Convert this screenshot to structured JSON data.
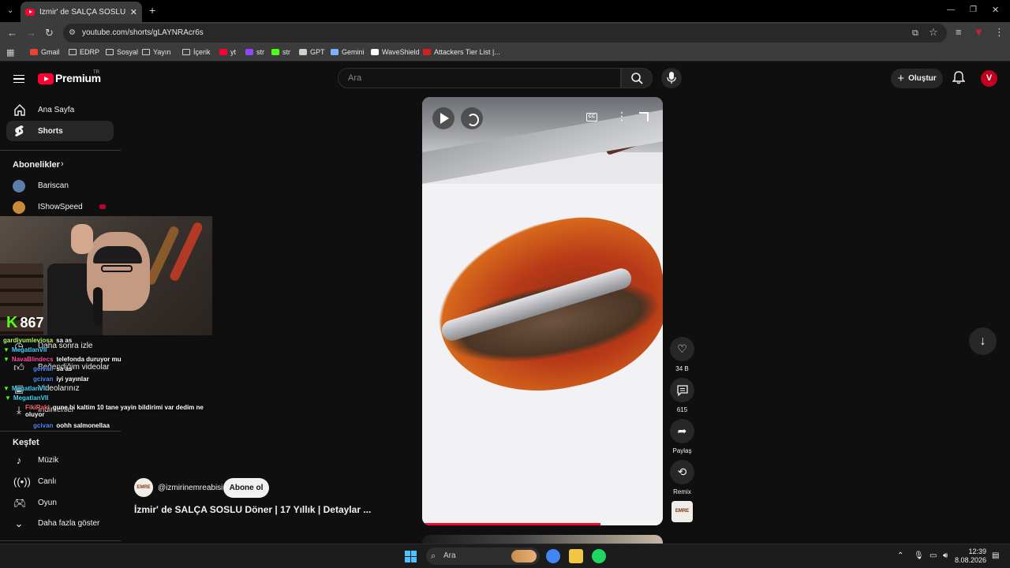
{
  "browser": {
    "tab_title": "İzmir' de SALÇA SOSLU Döner | ",
    "url": "youtube.com/shorts/gLAYNRAcr6s",
    "bookmarks": [
      {
        "label": "Gmail",
        "icon": "gmail-icon",
        "color": "#ea4335"
      },
      {
        "label": "EDRP",
        "icon": "folder-icon",
        "color": ""
      },
      {
        "label": "Sosyal",
        "icon": "folder-icon",
        "color": ""
      },
      {
        "label": "Yayın",
        "icon": "folder-icon",
        "color": ""
      },
      {
        "label": "İçerik",
        "icon": "folder-icon",
        "color": ""
      },
      {
        "label": "yt",
        "icon": "youtube-icon",
        "color": "#ff0033"
      },
      {
        "label": "str",
        "icon": "twitch-icon",
        "color": "#9146ff"
      },
      {
        "label": "str",
        "icon": "kick-icon",
        "color": "#53fc18"
      },
      {
        "label": "GPT",
        "icon": "openai-icon",
        "color": "#cfcfcf"
      },
      {
        "label": "Gemini",
        "icon": "gemini-icon",
        "color": "#7fb2ff"
      },
      {
        "label": "WaveShield",
        "icon": "waveshield-icon",
        "color": "#ffffff"
      },
      {
        "label": "Attackers Tier List |...",
        "icon": "tierlist-icon",
        "color": "#d02020"
      }
    ]
  },
  "header": {
    "logo_text": "Premium",
    "region": "TR",
    "search_placeholder": "Ara",
    "create_label": "Oluştur",
    "avatar_letter": "V"
  },
  "sidebar": {
    "main": [
      {
        "label": "Ana Sayfa",
        "icon": "home-icon"
      },
      {
        "label": "Shorts",
        "icon": "shorts-icon",
        "active": true
      }
    ],
    "subscriptions_heading": "Abonelikler",
    "subscriptions": [
      {
        "label": "Bariscan",
        "color": "#5b7ea8"
      },
      {
        "label": "IShowSpeed",
        "color": "#c98b3a"
      }
    ],
    "you_items": [
      {
        "label": "Daha sonra izle",
        "icon": "watch-later-icon"
      },
      {
        "label": "Beğendiğim videolar",
        "icon": "like-icon"
      },
      {
        "label": "Videolarınız",
        "icon": "your-videos-icon"
      },
      {
        "label": "İndirilenler",
        "icon": "download-icon"
      }
    ],
    "explore_heading": "Keşfet",
    "explore": [
      {
        "label": "Müzik",
        "icon": "music-icon"
      },
      {
        "label": "Canlı",
        "icon": "live-icon"
      },
      {
        "label": "Oyun",
        "icon": "gaming-icon"
      },
      {
        "label": "Daha fazla göster",
        "icon": "chevron-down-icon"
      }
    ]
  },
  "stream_overlay": {
    "viewer_count": "867",
    "chat": [
      {
        "user": "gardiyumleviosa",
        "msg": "sa as",
        "color": "#b6ff6a",
        "badge": ""
      },
      {
        "user": "MegatlanVII",
        "msg": "",
        "color": "#41d7ff",
        "badge": "▼"
      },
      {
        "user": "NavaBlindecs",
        "msg": "telefonda duruyor mu",
        "color": "#ff4f9a",
        "badge": "▼"
      },
      {
        "user": "gcivan",
        "msg": "sa as",
        "color": "#4f8bff",
        "badge": ""
      },
      {
        "user": "gcivan",
        "msg": "iyi yayınlar",
        "color": "#4f8bff",
        "badge": ""
      },
      {
        "user": "MegatlanVII",
        "msg": "",
        "color": "#41d7ff",
        "badge": "▼"
      },
      {
        "user": "MegatlanVII",
        "msg": "",
        "color": "#41d7ff",
        "badge": "▼"
      },
      {
        "user": "FikiRaki",
        "msg": "gune bi kaltim 10 tane yayin bildirimi var dedim ne oluyor",
        "color": "#ff6a6a",
        "badge": ""
      },
      {
        "user": "gcivan",
        "msg": "oohh salmonellaa",
        "color": "#4f8bff",
        "badge": ""
      }
    ]
  },
  "player": {
    "progress": 0.74,
    "cc_label": "CC"
  },
  "actions": {
    "likes": "34 B",
    "comments": "615",
    "share_label": "Paylaş",
    "remix_label": "Remix"
  },
  "video": {
    "channel": "@izmirinemreabisi",
    "subscribe_label": "Abone ol",
    "title": "İzmir' de SALÇA SOSLU Döner | 17 Yıllık | Detaylar ...",
    "channel_avatar_text": "EMRE",
    "audio_thumb_text": "EMRE"
  },
  "taskbar": {
    "search_placeholder": "Ara",
    "time": "12:39",
    "date": "8.08.2026",
    "apps": [
      {
        "name": "chrome-icon",
        "color": "#4285f4"
      },
      {
        "name": "file-explorer-icon",
        "color": "#f2c744"
      },
      {
        "name": "spotify-icon",
        "color": "#1ed760"
      }
    ]
  }
}
